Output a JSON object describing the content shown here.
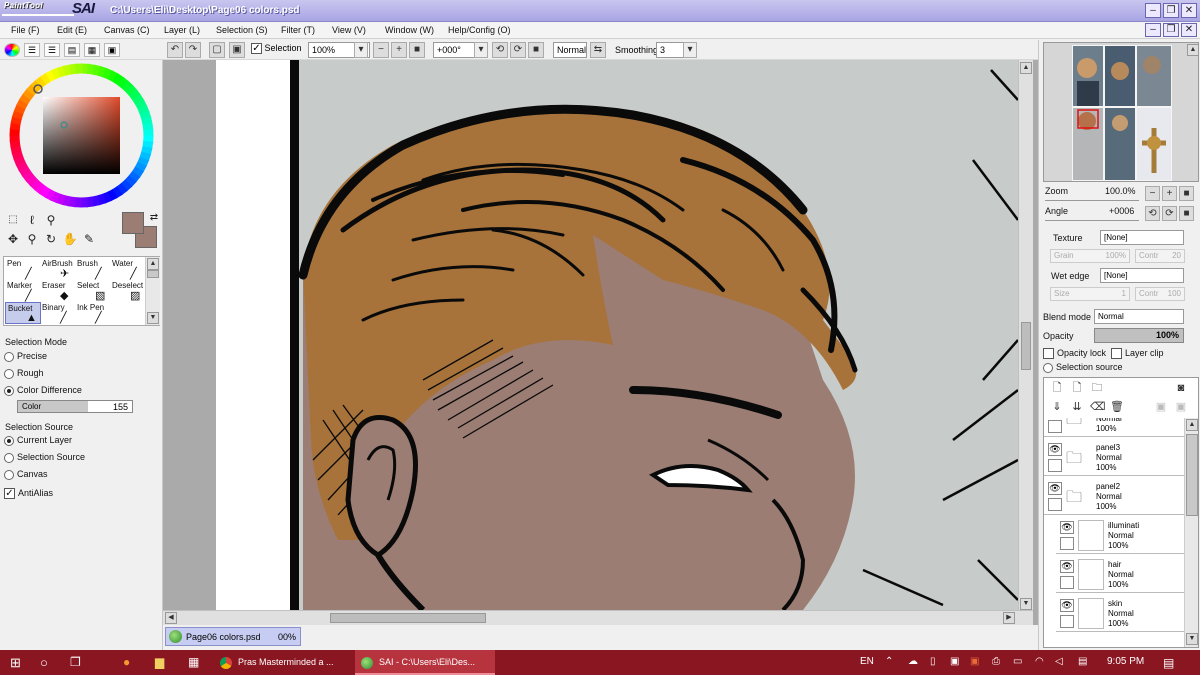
{
  "window": {
    "logo_top": "PaintTool",
    "logo_main": "SAI",
    "title": "C:\\Users\\Eli\\Desktop\\Page06 colors.psd",
    "controls": [
      "–",
      "❐",
      "✕"
    ]
  },
  "menu": [
    "File (F)",
    "Edit (E)",
    "Canvas (C)",
    "Layer (L)",
    "Selection (S)",
    "Filter (T)",
    "View (V)",
    "Window (W)",
    "Help/Config (O)"
  ],
  "toolbar": {
    "selection_label": "Selection",
    "selection_checked": true,
    "zoom": "100%",
    "angle": "+000°",
    "blend": "Normal",
    "smoothing_label": "Smoothing",
    "smoothing": "3"
  },
  "left": {
    "current_color": "#9b7d73",
    "brushes": [
      {
        "label": "Pen",
        "icon": "pen-icon"
      },
      {
        "label": "AirBrush",
        "icon": "airbrush-icon"
      },
      {
        "label": "Brush",
        "icon": "brush-icon"
      },
      {
        "label": "Water",
        "icon": "water-icon"
      },
      {
        "label": "Marker",
        "icon": "marker-icon"
      },
      {
        "label": "Eraser",
        "icon": "eraser-icon"
      },
      {
        "label": "Select",
        "icon": "select-icon"
      },
      {
        "label": "Deselect",
        "icon": "deselect-icon"
      },
      {
        "label": "Bucket",
        "icon": "bucket-icon",
        "selected": true
      },
      {
        "label": "Binary",
        "icon": "binary-icon"
      },
      {
        "label": "Ink Pen",
        "icon": "inkpen-icon"
      }
    ],
    "selection_mode_heading": "Selection Mode",
    "selection_modes": [
      {
        "label": "Precise",
        "checked": false
      },
      {
        "label": "Rough",
        "checked": false
      },
      {
        "label": "Color Difference",
        "checked": true
      }
    ],
    "color_slider": {
      "label": "Color",
      "value": "155",
      "fraction": 0.61
    },
    "selection_source_heading": "Selection Source",
    "selection_sources": [
      {
        "label": "Current Layer",
        "checked": true
      },
      {
        "label": "Selection Source",
        "checked": false
      },
      {
        "label": "Canvas",
        "checked": false
      }
    ],
    "antialias_label": "AntiAlias",
    "antialias_checked": true
  },
  "document_tab": {
    "name": "Page06 colors.psd",
    "percent": "00%"
  },
  "right": {
    "zoom_label": "Zoom",
    "zoom_value": "100.0%",
    "angle_label": "Angle",
    "angle_value": "+0006",
    "texture_label": "Texture",
    "texture_value": "[None]",
    "grain_label": "Grain",
    "grain_value": "100%",
    "contr_label": "Contr",
    "contr_value": "20",
    "wetedge_label": "Wet edge",
    "wetedge_value": "[None]",
    "size_label": "Size",
    "size_value": "1",
    "contr2_label": "Contr",
    "contr2_value": "100",
    "blend_label": "Blend mode",
    "blend_value": "Normal",
    "opacity_label": "Opacity",
    "opacity_value": "100%",
    "opacity_lock": "Opacity lock",
    "layer_clip": "Layer clip",
    "selection_source": "Selection source",
    "layers": [
      {
        "name": "",
        "mode": "Normal",
        "opacity": "100%",
        "type": "folder",
        "partial": true
      },
      {
        "name": "panel3",
        "mode": "Normal",
        "opacity": "100%",
        "type": "folder"
      },
      {
        "name": "panel2",
        "mode": "Normal",
        "opacity": "100%",
        "type": "folder-open"
      },
      {
        "name": "illuminati",
        "mode": "Normal",
        "opacity": "100%",
        "type": "layer"
      },
      {
        "name": "hair",
        "mode": "Normal",
        "opacity": "100%",
        "type": "layer"
      },
      {
        "name": "skin",
        "mode": "Normal",
        "opacity": "100%",
        "type": "layer"
      }
    ]
  },
  "taskbar": {
    "apps": [
      {
        "label": "Pras Masterminded a ...",
        "active": false
      },
      {
        "label": "SAI - C:\\Users\\Eli\\Des...",
        "active": true
      }
    ],
    "lang": "EN",
    "time": "9:05 PM"
  },
  "colors": {
    "hair": "#a8733a",
    "skin": "#9b7d73",
    "bg": "#c7cbc9",
    "ink": "#0a0a0a"
  }
}
